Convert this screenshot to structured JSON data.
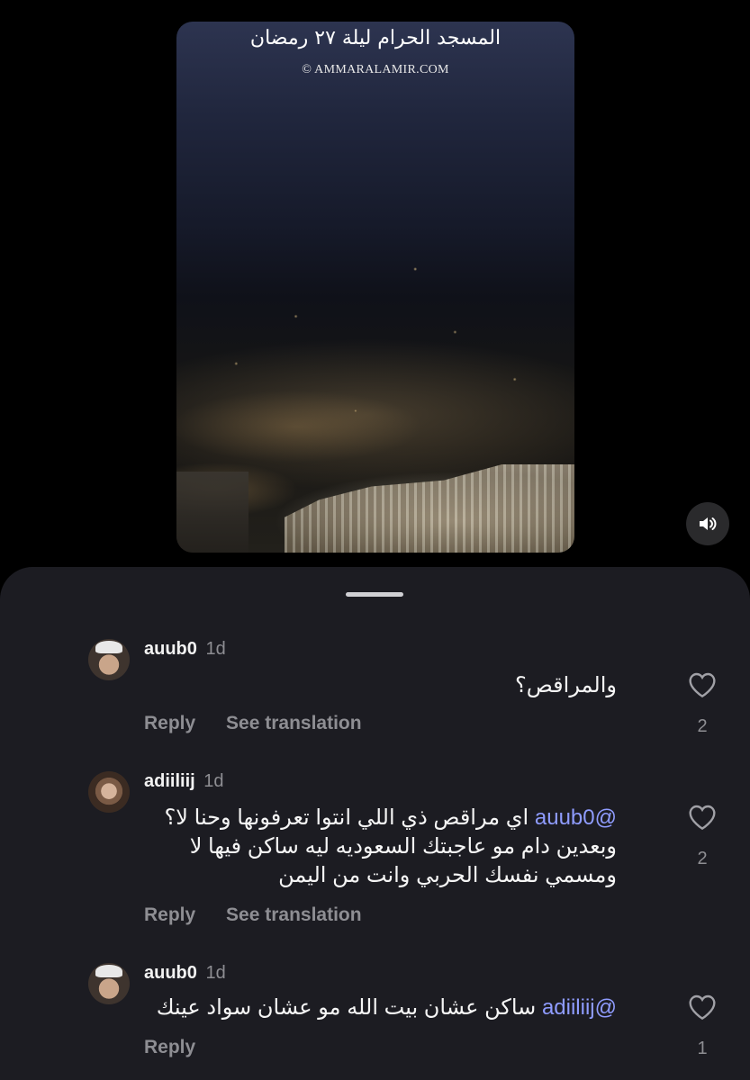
{
  "video": {
    "title": "المسجد الحرام ليلة ٢٧ رمضان",
    "credit": "© AMMARALAMIR.COM"
  },
  "icons": {
    "sound": "speaker-icon",
    "like": "heart-icon"
  },
  "colors": {
    "sheet_bg": "#1c1c22",
    "mention": "#8f9cff",
    "secondary_text": "#8e8e93"
  },
  "comments": [
    {
      "username": "auub0",
      "time": "1d",
      "mention": "",
      "text": "والمراقص؟",
      "reply_label": "Reply",
      "translate_label": "See translation",
      "likes": "2"
    },
    {
      "username": "adiiliij",
      "time": "1d",
      "mention": "@auub0",
      "text": "اي مراقص ذي اللي انتوا تعرفونها وحنا لا؟ وبعدين دام مو عاجبتك السعوديه ليه ساكن فيها لا ومسمي نفسك الحربي وانت من اليمن",
      "reply_label": "Reply",
      "translate_label": "See translation",
      "likes": "2"
    },
    {
      "username": "auub0",
      "time": "1d",
      "mention": "@adiiliij",
      "text": "ساكن عشان بيت الله مو عشان سواد عينك",
      "reply_label": "Reply",
      "translate_label": "",
      "likes": "1"
    }
  ]
}
